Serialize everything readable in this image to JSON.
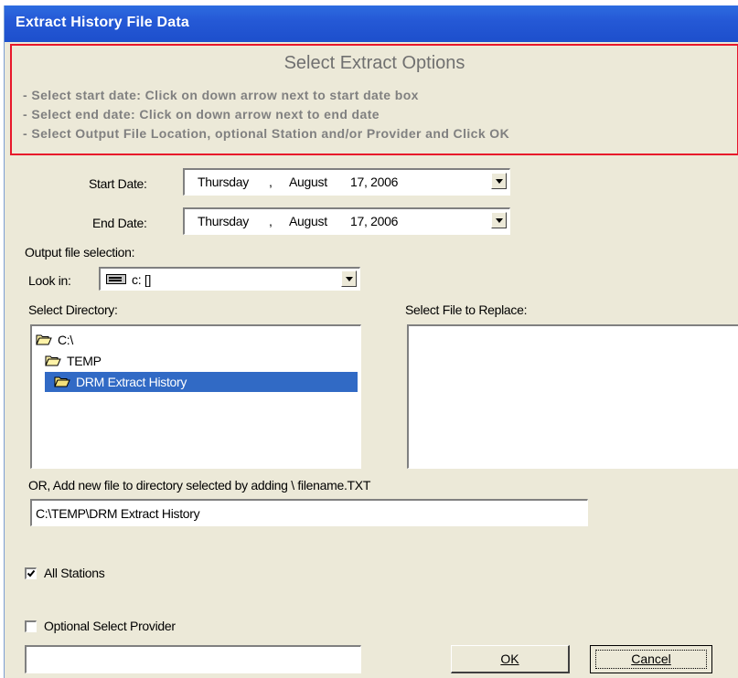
{
  "window": {
    "title": "Extract History File Data"
  },
  "instructions": {
    "heading": "Select Extract Options",
    "lines": [
      "-  Select start date: Click on down arrow next to start date box",
      "-  Select end date:  Click on down arrow next to end date",
      "-  Select Output File Location, optional Station and/or Provider and Click OK"
    ]
  },
  "start_date": {
    "label": "Start Date:",
    "weekday": "Thursday",
    "sep": ",",
    "month": "August",
    "day_year": "17, 2006"
  },
  "end_date": {
    "label": "End Date:",
    "weekday": "Thursday",
    "sep": ",",
    "month": "August",
    "day_year": "17, 2006"
  },
  "output_selection": {
    "label": "Output file selection:"
  },
  "look_in": {
    "label": "Look in:",
    "drive": "c: []",
    "icon": "drive-icon"
  },
  "directory": {
    "label": "Select Directory:",
    "items": [
      {
        "name": "C:\\",
        "icon": "open-folder-icon",
        "selected": false
      },
      {
        "name": "TEMP",
        "icon": "open-folder-icon",
        "selected": false
      },
      {
        "name": "DRM Extract History",
        "icon": "open-folder-icon",
        "selected": true
      }
    ]
  },
  "file_replace": {
    "label": "Select File to Replace:"
  },
  "new_file": {
    "label": "OR, Add new file to directory selected by adding  \\ filename.TXT",
    "value": "C:\\TEMP\\DRM Extract History"
  },
  "all_stations": {
    "label": "All Stations",
    "checked": true
  },
  "provider": {
    "label": "Optional Select Provider",
    "checked": false,
    "value": ""
  },
  "buttons": {
    "ok": "OK",
    "cancel": "Cancel"
  },
  "colors": {
    "titlebar": "#2559d6",
    "dialog_bg": "#ece9d8",
    "instruction_border": "#e8172a",
    "selection": "#316ac5"
  }
}
